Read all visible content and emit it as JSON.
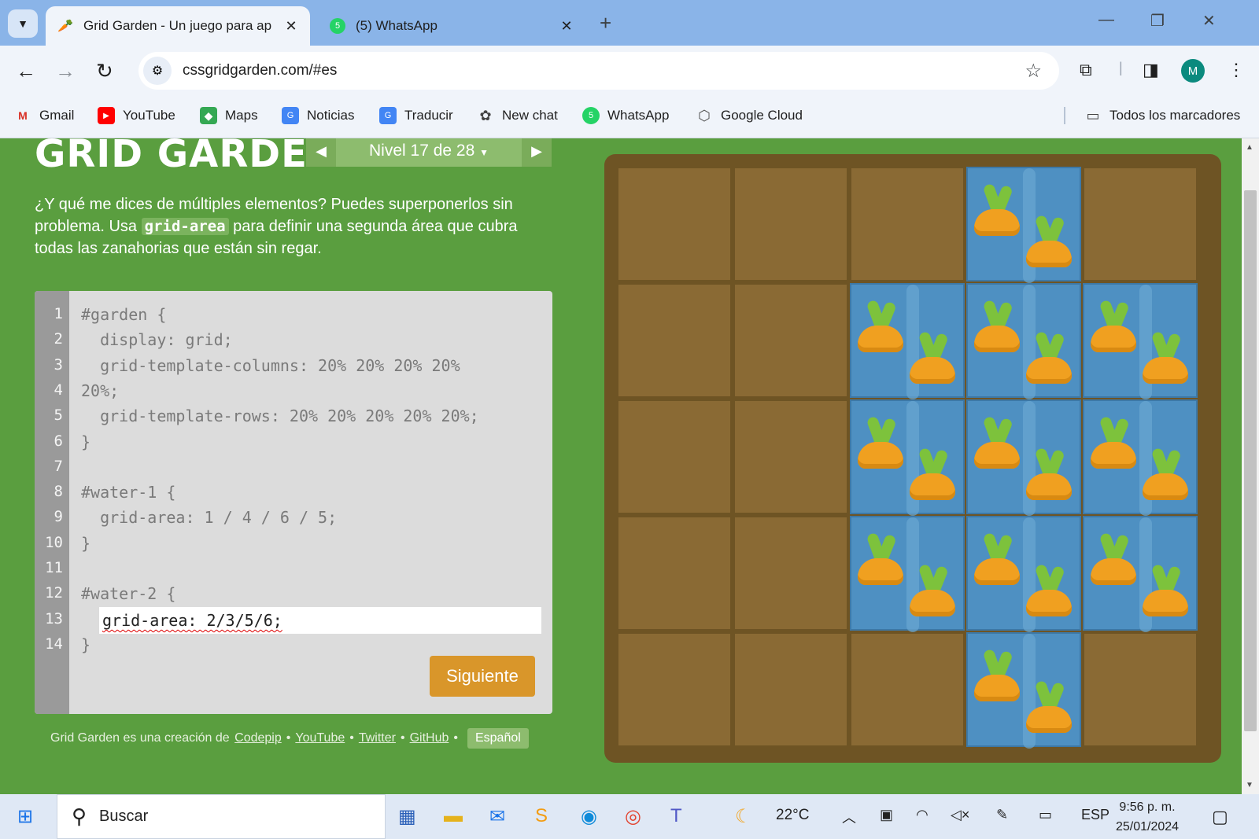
{
  "browser": {
    "tabs": [
      {
        "title": "Grid Garden - Un juego para ap",
        "active": true,
        "favicon": "carrot-icon"
      },
      {
        "title": "(5) WhatsApp",
        "active": false,
        "favicon": "whatsapp-icon",
        "badge": "5"
      }
    ],
    "new_tab": "+",
    "url": "cssgridgarden.com/#es",
    "avatar_letter": "M",
    "bookmarks": [
      {
        "label": "Gmail",
        "icon": "gmail-icon"
      },
      {
        "label": "YouTube",
        "icon": "youtube-icon"
      },
      {
        "label": "Maps",
        "icon": "maps-icon"
      },
      {
        "label": "Noticias",
        "icon": "news-icon"
      },
      {
        "label": "Traducir",
        "icon": "translate-icon"
      },
      {
        "label": "New chat",
        "icon": "chatgpt-icon"
      },
      {
        "label": "WhatsApp",
        "icon": "whatsapp-icon"
      },
      {
        "label": "Google Cloud",
        "icon": "google-cloud-icon"
      }
    ],
    "all_bookmarks": "Todos los marcadores"
  },
  "game": {
    "logo": "GRID GARDEN",
    "level_label": "Nivel 17 de 28",
    "instructions_before": "¿Y qué me dices de múltiples elementos? Puedes superponerlos sin problema. Usa ",
    "instructions_code": "grid-area",
    "instructions_after": " para definir una segunda área que cubra todas las zanahorias que están sin regar.",
    "line_numbers": [
      "1",
      "2",
      "3",
      "4",
      "5",
      "6",
      "7",
      "8",
      "9",
      "10",
      "11",
      "12",
      "13",
      "14"
    ],
    "code_lines": [
      "#garden {",
      "  display: grid;",
      "  grid-template-columns: 20% 20% 20% 20%",
      "20%;",
      "  grid-template-rows: 20% 20% 20% 20% 20%;",
      "}",
      "",
      "#water-1 {",
      "  grid-area: 1 / 4 / 6 / 5;",
      "}",
      "",
      "#water-2 {",
      "}"
    ],
    "input_value": "grid-area: 2/3/5/6;",
    "next_button": "Siguiente",
    "footer": {
      "prefix": "Grid Garden es una creación de",
      "links": [
        "Codepip",
        "YouTube",
        "Twitter",
        "GitHub"
      ],
      "separator": "•",
      "language": "Español"
    }
  },
  "taskbar": {
    "search_placeholder": "Buscar",
    "weather": "22°C",
    "language": "ESP",
    "time": "9:56 p. m.",
    "date": "25/01/2024"
  }
}
